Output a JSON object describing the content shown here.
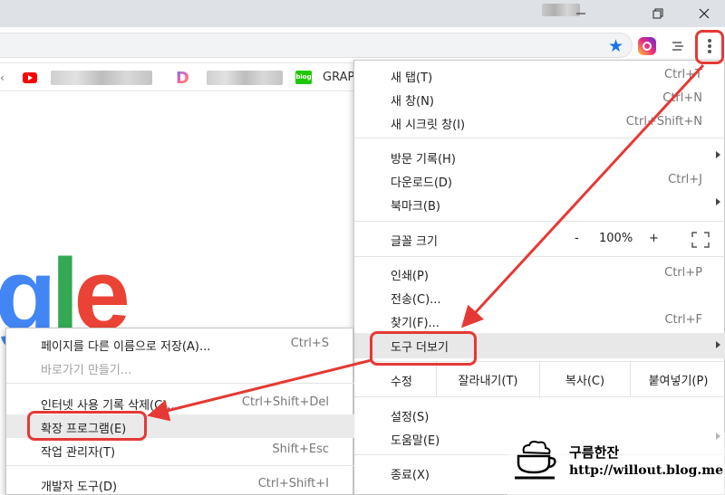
{
  "window": {
    "minimize_icon": "minimize-icon",
    "maximize_icon": "restore-icon",
    "close_icon": "close-icon"
  },
  "toolbar": {
    "bookmark_icon": "star-icon",
    "extensions": [
      "instagram-icon",
      "list-icon"
    ],
    "menu_icon": "kebab-menu-icon"
  },
  "bookmarks": {
    "chevron": "‹",
    "items": [
      {
        "icon": "youtube-icon"
      },
      {
        "icon": "d-logo-icon"
      },
      {
        "icon": "blog-icon",
        "icon_text": "blog",
        "label": "GRAP"
      }
    ]
  },
  "page": {
    "logo_fragment": [
      "g",
      "l",
      "e"
    ]
  },
  "menu": {
    "new_tab": {
      "label": "새 탭(T)",
      "shortcut": "Ctrl+T"
    },
    "new_window": {
      "label": "새 창(N)",
      "shortcut": "Ctrl+N"
    },
    "incognito": {
      "label": "새 시크릿 창(I)",
      "shortcut": "Ctrl+Shift+N"
    },
    "history": {
      "label": "방문 기록(H)"
    },
    "downloads": {
      "label": "다운로드(D)",
      "shortcut": "Ctrl+J"
    },
    "bookmarks": {
      "label": "북마크(B)"
    },
    "zoom": {
      "label": "글꼴 크기",
      "minus": "-",
      "value": "100%",
      "plus": "+"
    },
    "print": {
      "label": "인쇄(P)",
      "shortcut": "Ctrl+P"
    },
    "cast": {
      "label": "전송(C)..."
    },
    "find": {
      "label": "찾기(F)...",
      "shortcut": "Ctrl+F"
    },
    "more_tools": {
      "label": "도구 더보기"
    },
    "edit": {
      "label": "수정",
      "cut": "잘라내기(T)",
      "copy": "복사(C)",
      "paste": "붙여넣기(P)"
    },
    "settings": {
      "label": "설정(S)"
    },
    "help": {
      "label": "도움말(E)"
    },
    "exit": {
      "label": "종료(X)"
    }
  },
  "submenu": {
    "save_page": {
      "label": "페이지를 다른 이름으로 저장(A)...",
      "shortcut": "Ctrl+S"
    },
    "create_shortcut": {
      "label": "바로가기 만들기..."
    },
    "clear_data": {
      "label": "인터넷 사용 기록 삭제(C)...",
      "shortcut": "Ctrl+Shift+Del"
    },
    "extensions": {
      "label": "확장 프로그램(E)"
    },
    "task_manager": {
      "label": "작업 관리자(T)",
      "shortcut": "Shift+Esc"
    },
    "dev_tools": {
      "label": "개발자 도구(D)",
      "shortcut": "Ctrl+Shift+I"
    }
  },
  "watermark": {
    "title": "구름한잔",
    "url": "http://willout.blog.me",
    "icon": "coffee-cup-icon"
  },
  "annotation_color": "#e53935"
}
